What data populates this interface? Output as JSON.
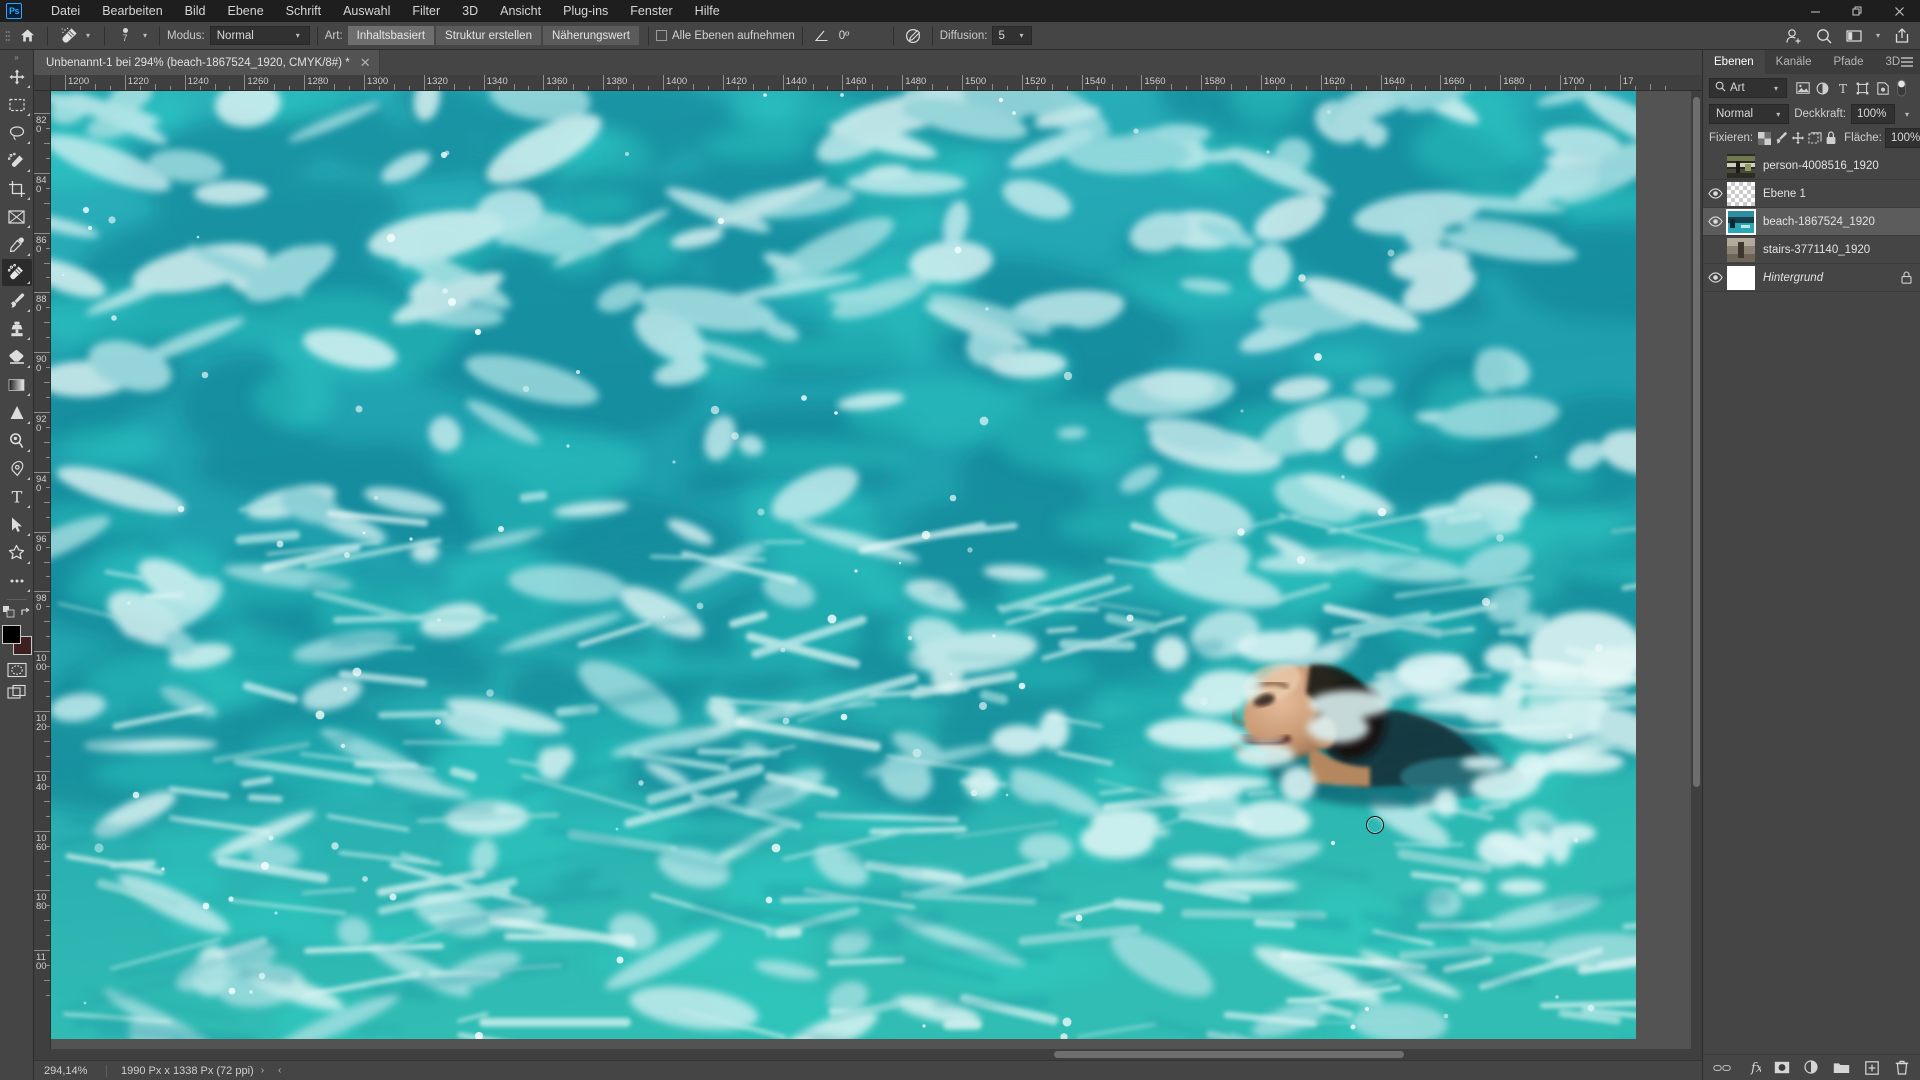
{
  "app": {
    "name": "Adobe Photoshop",
    "logo_text": "Ps"
  },
  "menubar": {
    "items": [
      {
        "label": "Datei"
      },
      {
        "label": "Bearbeiten"
      },
      {
        "label": "Bild"
      },
      {
        "label": "Ebene"
      },
      {
        "label": "Schrift"
      },
      {
        "label": "Auswahl"
      },
      {
        "label": "Filter"
      },
      {
        "label": "3D"
      },
      {
        "label": "Ansicht"
      },
      {
        "label": "Plug-ins"
      },
      {
        "label": "Fenster"
      },
      {
        "label": "Hilfe"
      }
    ]
  },
  "window_controls": {
    "minimize": "—",
    "maximize": "❐",
    "close": "✕"
  },
  "options_bar": {
    "tool": "spot-healing-brush",
    "brush_size": "7",
    "mode_label": "Modus:",
    "mode_value": "Normal",
    "type_label": "Art:",
    "type_buttons": [
      {
        "label": "Inhaltsbasiert",
        "active": true
      },
      {
        "label": "Struktur erstellen",
        "active": false
      },
      {
        "label": "Näherungswert",
        "active": false
      }
    ],
    "sample_all_layers_label": "Alle Ebenen aufnehmen",
    "sample_all_layers_checked": false,
    "angle_value": "0º",
    "diffusion_label": "Diffusion:",
    "diffusion_value": "5",
    "right_icons": [
      {
        "name": "add-user-icon"
      },
      {
        "name": "search-icon"
      },
      {
        "name": "workspace-layout-icon"
      },
      {
        "name": "chevron-down-icon"
      },
      {
        "name": "share-icon"
      }
    ]
  },
  "toolbar": {
    "tools": [
      {
        "name": "move-tool",
        "label": "Verschieben"
      },
      {
        "name": "rectangular-marquee-tool",
        "label": "Auswahlrechteck"
      },
      {
        "name": "lasso-tool",
        "label": "Lasso"
      },
      {
        "name": "object-selection-tool",
        "label": "Objektauswahl"
      },
      {
        "name": "crop-tool",
        "label": "Freistellungswerkzeug"
      },
      {
        "name": "frame-tool",
        "label": "Rahmen"
      },
      {
        "name": "eyedropper-tool",
        "label": "Pipette"
      },
      {
        "name": "spot-healing-brush-tool",
        "label": "Bereichsreparatur-Pinsel",
        "active": true
      },
      {
        "name": "brush-tool",
        "label": "Pinsel"
      },
      {
        "name": "clone-stamp-tool",
        "label": "Kopierstempel"
      },
      {
        "name": "eraser-tool",
        "label": "Radiergummi"
      },
      {
        "name": "gradient-tool",
        "label": "Verlaufswerkzeug"
      },
      {
        "name": "blur-tool",
        "label": "Weichzeichner"
      },
      {
        "name": "dodge-tool",
        "label": "Abwedler"
      },
      {
        "name": "pen-tool",
        "label": "Zeichenstift"
      },
      {
        "name": "type-tool",
        "label": "Text"
      },
      {
        "name": "path-selection-tool",
        "label": "Pfadauswahl"
      },
      {
        "name": "custom-shape-tool",
        "label": "Eigene Form"
      },
      {
        "name": "more-tools",
        "label": "Weitere Werkzeuge"
      }
    ],
    "foreground_color": "#000000",
    "background_color": "#3d2020",
    "quick_mask_label": "Im Maskierungsmodus arbeiten",
    "screen_mode_label": "Bildschirmmodus"
  },
  "document": {
    "tab_title": "Unbenannt-1 bei 294% (beach-1867524_1920, CMYK/8#) *",
    "close_glyph": "✕"
  },
  "rulers": {
    "horizontal": [
      "1200",
      "1220",
      "1240",
      "1260",
      "1280",
      "1300",
      "1320",
      "1340",
      "1360",
      "1380",
      "1400",
      "1420",
      "1440",
      "1460",
      "1480",
      "1500",
      "1520",
      "1540",
      "1560",
      "1580",
      "1600",
      "1620",
      "1640",
      "1660",
      "1680",
      "1700",
      "17"
    ],
    "vertical": [
      "820",
      "840",
      "860",
      "880",
      "900",
      "920",
      "940",
      "960",
      "980",
      "1000",
      "1020",
      "1040",
      "1060",
      "1080",
      "1100"
    ]
  },
  "status_bar": {
    "zoom": "294,14%",
    "doc_info": "1990 Px x 1338 Px (72 ppi)",
    "next_glyph": "›",
    "prev_glyph": "‹"
  },
  "layers_panel": {
    "tabs": [
      {
        "label": "Ebenen",
        "active": true
      },
      {
        "label": "Kanäle",
        "active": false
      },
      {
        "label": "Pfade",
        "active": false
      },
      {
        "label": "3D",
        "active": false
      }
    ],
    "filter_label": "Art",
    "filter_icons": [
      {
        "name": "filter-pixel-icon"
      },
      {
        "name": "filter-adjustment-icon"
      },
      {
        "name": "filter-type-icon"
      },
      {
        "name": "filter-shape-icon"
      },
      {
        "name": "filter-smart-object-icon"
      }
    ],
    "blend_mode": "Normal",
    "opacity_label": "Deckkraft:",
    "opacity_value": "100%",
    "lock_label": "Fixieren:",
    "lock_icons": [
      {
        "name": "lock-transparent-pixels-icon"
      },
      {
        "name": "lock-image-pixels-icon"
      },
      {
        "name": "lock-position-icon"
      },
      {
        "name": "lock-artboard-nesting-icon"
      },
      {
        "name": "lock-all-icon"
      }
    ],
    "fill_label": "Fläche:",
    "fill_value": "100%",
    "layers": [
      {
        "name": "person-4008516_1920",
        "visible": false,
        "selected": false,
        "kind": "image",
        "locked": false
      },
      {
        "name": "Ebene 1",
        "visible": true,
        "selected": false,
        "kind": "empty",
        "locked": false
      },
      {
        "name": "beach-1867524_1920",
        "visible": true,
        "selected": true,
        "kind": "image",
        "locked": false
      },
      {
        "name": "stairs-3771140_1920",
        "visible": false,
        "selected": false,
        "kind": "image",
        "locked": false
      },
      {
        "name": "Hintergrund",
        "visible": true,
        "selected": false,
        "kind": "white",
        "locked": true
      }
    ],
    "footer_icons": [
      {
        "name": "link-layers-icon"
      },
      {
        "name": "layer-style-fx-icon"
      },
      {
        "name": "add-layer-mask-icon"
      },
      {
        "name": "new-adjustment-layer-icon"
      },
      {
        "name": "new-group-icon"
      },
      {
        "name": "new-layer-icon"
      },
      {
        "name": "delete-layer-icon"
      }
    ]
  },
  "colors": {
    "accent": "#31a8ff",
    "panel_bg": "#454545",
    "canvas_bg": "#535353",
    "titlebar_bg": "#1e1e1e",
    "water_teal": "#22a3ad",
    "water_light": "#b8e4e6"
  }
}
